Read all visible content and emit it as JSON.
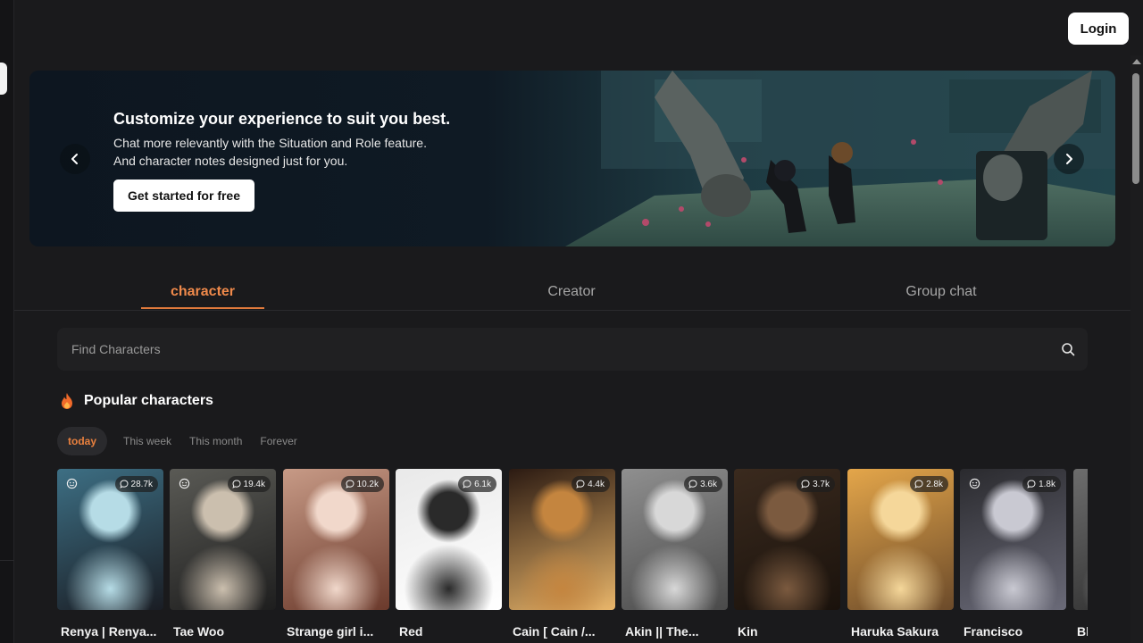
{
  "header": {
    "login_label": "Login"
  },
  "banner": {
    "title": "Customize your experience to suit you best.",
    "line1": "Chat more relevantly with the Situation and Role feature.",
    "line2": "And character notes designed just for you.",
    "cta_label": "Get started for free"
  },
  "tabs": [
    {
      "label": "character",
      "active": true
    },
    {
      "label": "Creator",
      "active": false
    },
    {
      "label": "Group chat",
      "active": false
    }
  ],
  "search": {
    "placeholder": "Find Characters"
  },
  "popular": {
    "title": "Popular characters",
    "periods": [
      {
        "label": "today",
        "active": true
      },
      {
        "label": "This week",
        "active": false
      },
      {
        "label": "This month",
        "active": false
      },
      {
        "label": "Forever",
        "active": false
      }
    ],
    "cards": [
      {
        "name": "Renya | Renya...",
        "count": "28.7k",
        "emoji": true,
        "colors": [
          "#3d6f84",
          "#b6dce6",
          "#1a1d24"
        ]
      },
      {
        "name": "Tae Woo",
        "count": "19.4k",
        "emoji": true,
        "colors": [
          "#5a5a55",
          "#cbbfae",
          "#1e1e1e"
        ]
      },
      {
        "name": "Strange girl i...",
        "count": "10.2k",
        "emoji": false,
        "colors": [
          "#c79a86",
          "#f1d8cb",
          "#6b3a2c"
        ]
      },
      {
        "name": "Red",
        "count": "6.1k",
        "emoji": false,
        "colors": [
          "#e9e9e9",
          "#2a2a2a",
          "#ffffff"
        ]
      },
      {
        "name": "Cain [ Cain /...",
        "count": "4.4k",
        "emoji": false,
        "colors": [
          "#2b1a12",
          "#c4853f",
          "#e8b56a"
        ]
      },
      {
        "name": "Akin || The...",
        "count": "3.6k",
        "emoji": false,
        "colors": [
          "#8f8f8f",
          "#d8d8d8",
          "#4a4a4a"
        ]
      },
      {
        "name": "Kin",
        "count": "3.7k",
        "emoji": false,
        "colors": [
          "#3a2a1e",
          "#7b5a3f",
          "#1a120c"
        ]
      },
      {
        "name": "Haruka Sakura",
        "count": "2.8k",
        "emoji": false,
        "colors": [
          "#e4a64a",
          "#f5d79a",
          "#6b4a2a"
        ]
      },
      {
        "name": "Francisco",
        "count": "1.8k",
        "emoji": true,
        "colors": [
          "#2a2a2e",
          "#c9c9d2",
          "#6a6a78"
        ]
      },
      {
        "name": "Bl",
        "count": "",
        "emoji": false,
        "colors": [
          "#6d6d6d",
          "#b8b8b8",
          "#2e2e2e"
        ]
      }
    ]
  },
  "colors": {
    "accent": "#e8803e",
    "background": "#1a1a1c"
  }
}
